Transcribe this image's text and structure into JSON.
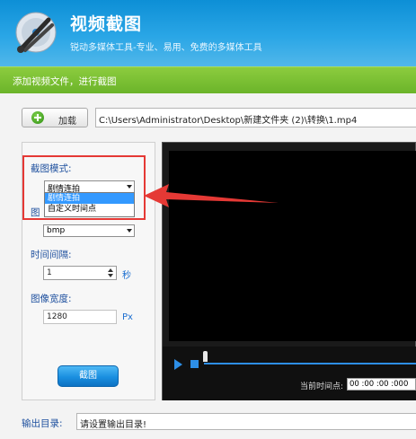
{
  "header": {
    "title": "视频截图",
    "subtitle": "锐动多媒体工具-专业、易用、免费的多媒体工具",
    "logo_icon": "scissors-disc-icon"
  },
  "step_bar": {
    "text": "添加视频文件，进行截图"
  },
  "load": {
    "button_label": "加载",
    "button_icon": "plus-circle-icon",
    "file_path": "C:\\Users\\Administrator\\Desktop\\新建文件夹 (2)\\转换\\1.mp4"
  },
  "left_panel": {
    "mode_label": "截图模式:",
    "mode_value": "剧情连拍",
    "mode_options": [
      "剧情连拍",
      "自定义时间点"
    ],
    "format_label_partial": "图",
    "format_value": "bmp",
    "interval_label": "时间间隔:",
    "interval_value": "1",
    "interval_unit": "秒",
    "width_label": "图像宽度:",
    "width_value": "1280",
    "width_unit": "Px",
    "capture_button": "截图"
  },
  "player": {
    "current_time_label": "当前时间点:",
    "current_time_value": "00 :00 :00 :000"
  },
  "output": {
    "label": "输出目录:",
    "placeholder": "请设置输出目录!"
  },
  "colors": {
    "header_blue": "#1a97dc",
    "step_green": "#7cc035",
    "accent_blue": "#2d8ee6",
    "highlight_red": "#e53935"
  }
}
